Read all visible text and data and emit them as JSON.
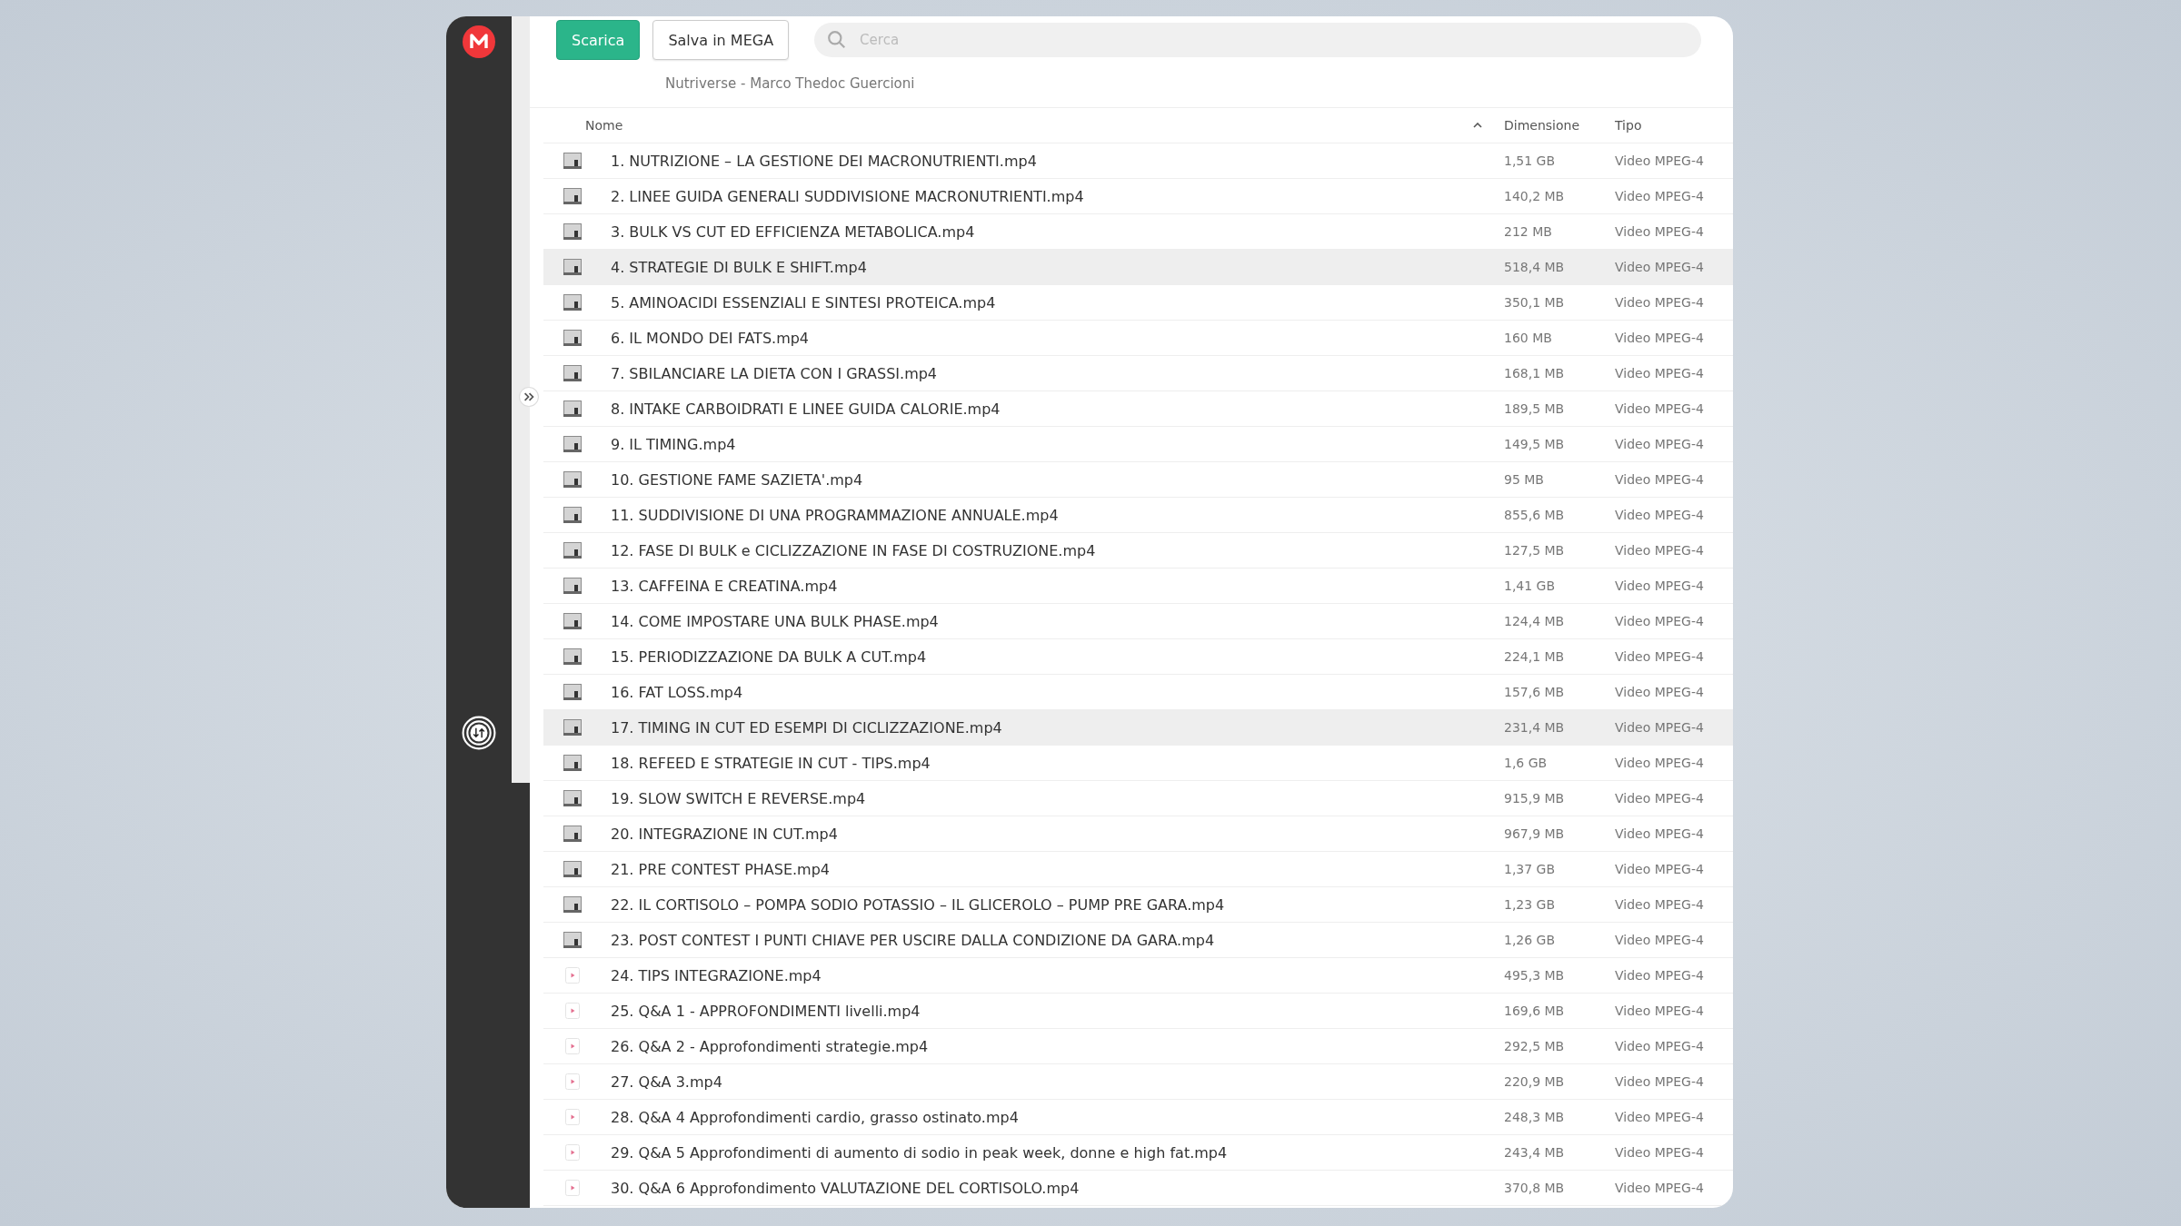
{
  "toolbar": {
    "buttons": [
      {
        "label": "Scarica",
        "kind": "primary"
      },
      {
        "label": "Salva in MEGA",
        "kind": "secondary"
      }
    ],
    "search": {
      "placeholder": "Cerca"
    }
  },
  "breadcrumb": "Nutriverse - Marco Thedoc Guercioni",
  "table": {
    "columns": [
      {
        "label": "Nome",
        "sorted": true
      },
      {
        "label": "Dimensione",
        "sorted": false
      },
      {
        "label": "Tipo",
        "sorted": false
      }
    ],
    "rows": [
      {
        "name": "1. NUTRIZIONE – LA GESTIONE DEI MACRONUTRIENTI.mp4",
        "size": "1,51 GB",
        "type": "Video MPEG-4",
        "kind": "thumbnail",
        "highlighted": false
      },
      {
        "name": "2. LINEE GUIDA GENERALI SUDDIVISIONE MACRONUTRIENTI.mp4",
        "size": "140,2 MB",
        "type": "Video MPEG-4",
        "kind": "thumbnail",
        "highlighted": false
      },
      {
        "name": "3. BULK VS CUT ED EFFICIENZA METABOLICA.mp4",
        "size": "212 MB",
        "type": "Video MPEG-4",
        "kind": "thumbnail",
        "highlighted": false
      },
      {
        "name": "4. STRATEGIE DI BULK E SHIFT.mp4",
        "size": "518,4 MB",
        "type": "Video MPEG-4",
        "kind": "thumbnail",
        "highlighted": true
      },
      {
        "name": "5. AMINOACIDI ESSENZIALI E SINTESI PROTEICA.mp4",
        "size": "350,1 MB",
        "type": "Video MPEG-4",
        "kind": "thumbnail",
        "highlighted": false
      },
      {
        "name": "6. IL MONDO DEI FATS.mp4",
        "size": "160 MB",
        "type": "Video MPEG-4",
        "kind": "thumbnail",
        "highlighted": false
      },
      {
        "name": "7. SBILANCIARE LA DIETA CON I GRASSI.mp4",
        "size": "168,1 MB",
        "type": "Video MPEG-4",
        "kind": "thumbnail",
        "highlighted": false
      },
      {
        "name": "8. INTAKE CARBOIDRATI E LINEE GUIDA CALORIE.mp4",
        "size": "189,5 MB",
        "type": "Video MPEG-4",
        "kind": "thumbnail",
        "highlighted": false
      },
      {
        "name": "9. IL TIMING.mp4",
        "size": "149,5 MB",
        "type": "Video MPEG-4",
        "kind": "thumbnail",
        "highlighted": false
      },
      {
        "name": "10. GESTIONE FAME SAZIETA'.mp4",
        "size": "95 MB",
        "type": "Video MPEG-4",
        "kind": "thumbnail",
        "highlighted": false
      },
      {
        "name": "11. SUDDIVISIONE DI UNA PROGRAMMAZIONE ANNUALE.mp4",
        "size": "855,6 MB",
        "type": "Video MPEG-4",
        "kind": "thumbnail",
        "highlighted": false
      },
      {
        "name": "12. FASE DI BULK e CICLIZZAZIONE IN FASE DI COSTRUZIONE.mp4",
        "size": "127,5 MB",
        "type": "Video MPEG-4",
        "kind": "thumbnail",
        "highlighted": false
      },
      {
        "name": "13. CAFFEINA E CREATINA.mp4",
        "size": "1,41 GB",
        "type": "Video MPEG-4",
        "kind": "thumbnail",
        "highlighted": false
      },
      {
        "name": "14. COME IMPOSTARE UNA BULK PHASE.mp4",
        "size": "124,4 MB",
        "type": "Video MPEG-4",
        "kind": "thumbnail",
        "highlighted": false
      },
      {
        "name": "15. PERIODIZZAZIONE DA BULK A CUT.mp4",
        "size": "224,1 MB",
        "type": "Video MPEG-4",
        "kind": "thumbnail",
        "highlighted": false
      },
      {
        "name": "16. FAT LOSS.mp4",
        "size": "157,6 MB",
        "type": "Video MPEG-4",
        "kind": "thumbnail",
        "highlighted": false
      },
      {
        "name": "17. TIMING IN CUT ED ESEMPI DI CICLIZZAZIONE.mp4",
        "size": "231,4 MB",
        "type": "Video MPEG-4",
        "kind": "thumbnail",
        "highlighted": true
      },
      {
        "name": "18. REFEED E STRATEGIE IN CUT - TIPS.mp4",
        "size": "1,6 GB",
        "type": "Video MPEG-4",
        "kind": "thumbnail",
        "highlighted": false
      },
      {
        "name": "19. SLOW SWITCH E REVERSE.mp4",
        "size": "915,9 MB",
        "type": "Video MPEG-4",
        "kind": "thumbnail",
        "highlighted": false
      },
      {
        "name": "20. INTEGRAZIONE IN CUT.mp4",
        "size": "967,9 MB",
        "type": "Video MPEG-4",
        "kind": "thumbnail",
        "highlighted": false
      },
      {
        "name": "21. PRE CONTEST PHASE.mp4",
        "size": "1,37 GB",
        "type": "Video MPEG-4",
        "kind": "thumbnail",
        "highlighted": false
      },
      {
        "name": "22. IL CORTISOLO – POMPA SODIO POTASSIO – IL GLICEROLO – PUMP PRE GARA.mp4",
        "size": "1,23 GB",
        "type": "Video MPEG-4",
        "kind": "thumbnail",
        "highlighted": false
      },
      {
        "name": "23. POST CONTEST I PUNTI CHIAVE PER USCIRE DALLA CONDIZIONE DA GARA.mp4",
        "size": "1,26 GB",
        "type": "Video MPEG-4",
        "kind": "thumbnail",
        "highlighted": false
      },
      {
        "name": "24. TIPS INTEGRAZIONE.mp4",
        "size": "495,3 MB",
        "type": "Video MPEG-4",
        "kind": "video-file",
        "highlighted": false
      },
      {
        "name": "25. Q&A 1 - APPROFONDIMENTI livelli.mp4",
        "size": "169,6 MB",
        "type": "Video MPEG-4",
        "kind": "video-file",
        "highlighted": false
      },
      {
        "name": "26. Q&A 2 - Approfondimenti strategie.mp4",
        "size": "292,5 MB",
        "type": "Video MPEG-4",
        "kind": "video-file",
        "highlighted": false
      },
      {
        "name": "27. Q&A 3.mp4",
        "size": "220,9 MB",
        "type": "Video MPEG-4",
        "kind": "video-file",
        "highlighted": false
      },
      {
        "name": "28. Q&A 4 Approfondimenti cardio, grasso ostinato.mp4",
        "size": "248,3 MB",
        "type": "Video MPEG-4",
        "kind": "video-file",
        "highlighted": false
      },
      {
        "name": "29. Q&A 5 Approfondimenti di aumento di sodio in peak week, donne e high fat.mp4",
        "size": "243,4 MB",
        "type": "Video MPEG-4",
        "kind": "video-file",
        "highlighted": false
      },
      {
        "name": "30. Q&A 6 Approfondimento VALUTAZIONE DEL CORTISOLO.mp4",
        "size": "370,8 MB",
        "type": "Video MPEG-4",
        "kind": "video-file",
        "highlighted": false
      }
    ]
  }
}
